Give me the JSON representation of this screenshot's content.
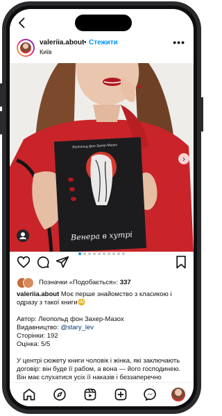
{
  "header": {
    "username": "valeriia.about",
    "separator": "•",
    "follow_label": "Стежити",
    "location": "Київ",
    "more_label": "•••"
  },
  "post": {
    "book_author": "Леопольд фон Захер-Мазох",
    "book_title": "Венера в хутрі",
    "carousel_count": 10,
    "carousel_active": 1
  },
  "likes": {
    "prefix": "Позначки «Подобається»: ",
    "count": "337"
  },
  "caption": {
    "username": "valeriia.about",
    "text": " Моє перше знайомство з класикою і одразу з такої книги😳",
    "author_line": "Автор: Леопольд фон Захер-Мазох",
    "publisher_prefix": "Видавництво: ",
    "publisher_link": "@stary_lev",
    "pages_line": "Сторінки: 192",
    "rating_line": "Оцінка: 5/5",
    "summary": "У центрі сюжету книги чоловік і жінка, які заключають договір: він буде її рабом, а вона — його господинею. Він має слухатися усіх її наказів і беззаперечно"
  },
  "colors": {
    "accent_blue": "#0095f6",
    "sweater_red": "#c8242a",
    "book_dark": "#1c1c1e"
  },
  "icons": [
    "back-icon",
    "more-icon",
    "heart-icon",
    "comment-icon",
    "share-icon",
    "bookmark-icon",
    "home-icon",
    "explore-icon",
    "reels-icon",
    "create-icon",
    "messenger-icon",
    "profile-avatar"
  ]
}
